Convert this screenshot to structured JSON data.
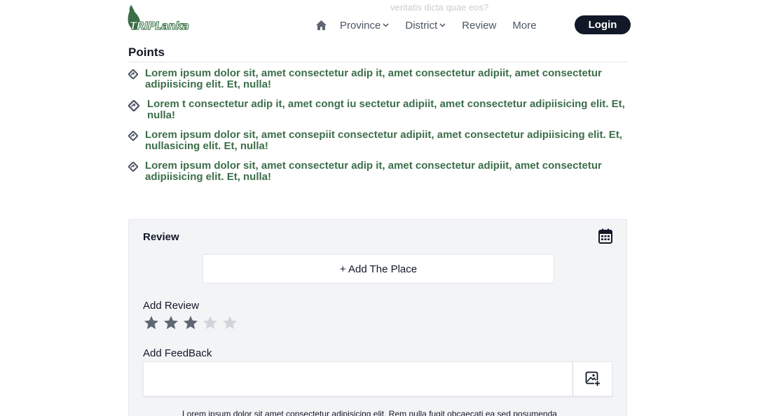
{
  "ghost_text": "veritatis dicta quae eos?",
  "header": {
    "logo_text": "TRIPLanka",
    "nav": {
      "province": "Province",
      "district": "District",
      "review": "Review",
      "more": "More"
    },
    "login_label": "Login"
  },
  "points": {
    "title": "Points",
    "items": [
      "Lorem ipsum dolor sit, amet consectetur adip it, amet consectetur adipiit, amet consectetur adipiisicing elit. Et, nulla!",
      "Lorem t consectetur adip it, amet congt iu sectetur adipiit, amet consectetur adipiisicing elit. Et, nulla!",
      "Lorem ipsum dolor sit, amet consepiit consectetur adipiit, amet consectetur adipiisicing elit. Et, nullasicing elit. Et, nulla!",
      "Lorem ipsum dolor sit, amet consectetur adip it, amet consectetur adipiit, amet consectetur adipiisicing elit. Et, nulla!"
    ]
  },
  "review": {
    "title": "Review",
    "add_place_label": "+ Add The Place",
    "add_review_label": "Add Review",
    "rating": 3,
    "max_rating": 5,
    "feedback_label": "Add FeedBack",
    "feedback_value": "",
    "footer_note": "Lorem ipsum dolor sit amet consectetur adipisicing elit. Rem nulla fugit obcaecati ea sed posumenda"
  },
  "colors": {
    "brand_green": "#3c6e49",
    "dark": "#111827",
    "star_filled": "#5f6672",
    "star_empty": "#d1d5db"
  }
}
